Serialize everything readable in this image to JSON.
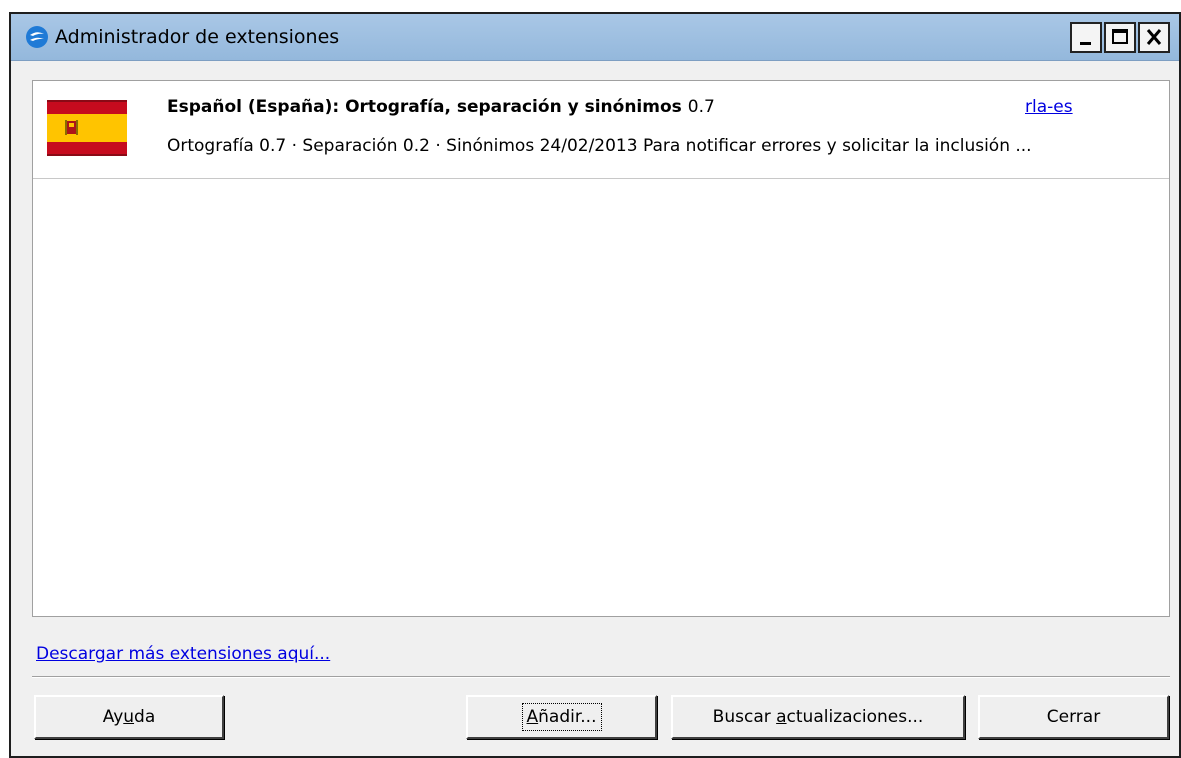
{
  "window": {
    "title": "Administrador de extensiones",
    "controls": {
      "minimize_icon": "minimize-icon",
      "maximize_icon": "maximize-icon",
      "close_icon": "close-icon"
    }
  },
  "extensions": [
    {
      "name": "Español (España): Ortografía, separación y sinónimos",
      "version": "0.7",
      "publisher": "rla-es",
      "description": "Ortografía 0.7 · Separación 0.2 · Sinónimos 24/02/2013 Para notificar errores y solicitar la inclusión ...",
      "icon": "spain-flag-icon"
    }
  ],
  "links": {
    "download_more": "Descargar más extensiones aquí..."
  },
  "buttons": {
    "help": {
      "pre": "Ay",
      "accel": "u",
      "post": "da"
    },
    "add": {
      "pre": "",
      "accel": "A",
      "post": "ñadir..."
    },
    "check_updates": {
      "pre": "Buscar ",
      "accel": "a",
      "post": "ctualizaciones..."
    },
    "close": {
      "pre": "Cerrar",
      "accel": "",
      "post": ""
    }
  },
  "colors": {
    "titlebar": "#a9c7e6",
    "link": "#0000e0",
    "flag_red": "#c60b1e",
    "flag_yellow": "#ffc400"
  }
}
